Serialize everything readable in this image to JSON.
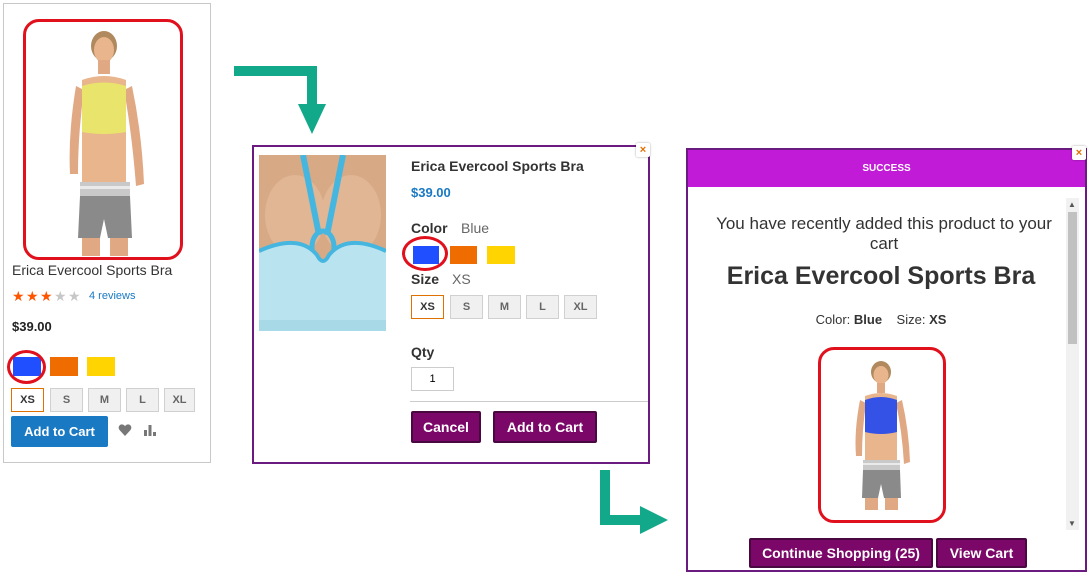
{
  "card": {
    "product_name": "Erica Evercool Sports Bra",
    "rating_percent": 60,
    "reviews_label": "4 reviews",
    "price": "$39.00",
    "swatches": [
      "#1f4fff",
      "#ef6c00",
      "#ffd400"
    ],
    "sizes": [
      "XS",
      "S",
      "M",
      "L",
      "XL"
    ],
    "selected_size": "XS",
    "add_to_cart_label": "Add to Cart",
    "wishlist_icon": "heart-icon",
    "compare_icon": "bar-chart-icon"
  },
  "quick_add": {
    "product_name": "Erica Evercool Sports Bra",
    "price": "$39.00",
    "color_label": "Color",
    "color_value": "Blue",
    "size_label": "Size",
    "size_value": "XS",
    "sizes": [
      "XS",
      "S",
      "M",
      "L",
      "XL"
    ],
    "qty_label": "Qty",
    "qty_value": "1",
    "cancel_label": "Cancel",
    "add_to_cart_label": "Add to Cart",
    "close_icon": "close-icon"
  },
  "success": {
    "header": "SUCCESS",
    "message": "You have recently added this product to your cart",
    "product_name": "Erica Evercool Sports Bra",
    "color_label": "Color:",
    "color_value": "Blue",
    "size_label": "Size:",
    "size_value": "XS",
    "continue_label": "Continue Shopping (25)",
    "view_cart_label": "View Cart",
    "close_icon": "close-icon"
  },
  "colors": {
    "accent_blue": "#1979c3",
    "purple": "#7b0868",
    "success_header": "#c21bd8",
    "highlight_red": "#e0101c",
    "arrow_teal": "#12a98a"
  }
}
